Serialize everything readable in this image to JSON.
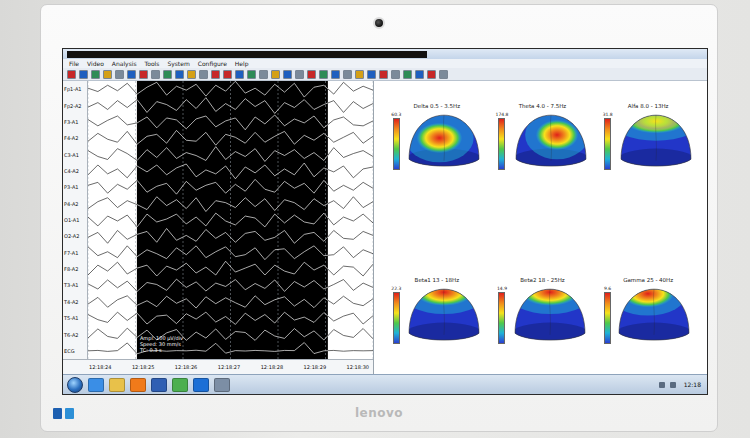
{
  "window": {
    "redacted": true
  },
  "menu": [
    "File",
    "Video",
    "Analysis",
    "Tools",
    "System",
    "Configure",
    "Help"
  ],
  "eeg": {
    "seconds": 6,
    "selection": {
      "start_s": 1.03,
      "end_s": 5.05
    },
    "overlay": [
      "Ampl: 100 µV/div",
      "Speed: 30 mm/s",
      "TC: 0.3 s"
    ],
    "time_ticks": [
      "12:18:24",
      "12:18:25",
      "12:18:26",
      "12:18:27",
      "12:18:28",
      "12:18:29",
      "12:18:30"
    ],
    "channels": [
      {
        "name": "Fp1-A1",
        "values": [
          5,
          -12,
          20,
          -8,
          30,
          -25,
          10,
          35,
          -30,
          15,
          -5,
          25,
          -35,
          20,
          -10,
          40,
          -20,
          5,
          -30,
          25,
          -15,
          30,
          -40,
          10,
          20,
          -25,
          35,
          -10,
          15,
          -5
        ]
      },
      {
        "name": "Fp2-A2",
        "values": [
          -8,
          15,
          -20,
          25,
          -10,
          30,
          -35,
          20,
          5,
          -25,
          30,
          -15,
          40,
          -30,
          10,
          -20,
          35,
          -5,
          25,
          -40,
          15,
          -10,
          30,
          -20,
          5,
          25,
          -35,
          20,
          -15,
          10
        ]
      },
      {
        "name": "F3-A1",
        "values": [
          12,
          -20,
          8,
          30,
          -15,
          -5,
          25,
          -30,
          20,
          10,
          -35,
          15,
          30,
          -25,
          5,
          20,
          -40,
          25,
          -10,
          35,
          -20,
          15,
          -5,
          30,
          -30,
          10,
          25,
          -15,
          -20,
          5
        ]
      },
      {
        "name": "F4-A2",
        "values": [
          -15,
          25,
          -5,
          -20,
          35,
          -30,
          10,
          20,
          -25,
          40,
          -10,
          -15,
          30,
          -35,
          20,
          5,
          -25,
          30,
          -20,
          10,
          35,
          -30,
          15,
          -10,
          25,
          -20,
          5,
          30,
          -25,
          10
        ]
      },
      {
        "name": "C3-A1",
        "values": [
          20,
          -10,
          -25,
          30,
          5,
          -30,
          25,
          -15,
          35,
          -20,
          10,
          -5,
          -30,
          40,
          -25,
          15,
          -10,
          30,
          -35,
          20,
          -5,
          25,
          -20,
          10,
          -30,
          35,
          -15,
          5,
          20,
          -10
        ]
      },
      {
        "name": "C4-A2",
        "values": [
          -20,
          30,
          -15,
          10,
          -35,
          25,
          -5,
          30,
          -20,
          15,
          35,
          -30,
          5,
          -15,
          25,
          -40,
          20,
          -10,
          30,
          -25,
          10,
          -20,
          40,
          -30,
          15,
          -5,
          25,
          -35,
          10,
          20
        ]
      },
      {
        "name": "P3-A1",
        "values": [
          10,
          25,
          -30,
          15,
          -10,
          35,
          -25,
          5,
          20,
          -35,
          30,
          -15,
          10,
          25,
          -30,
          15,
          -20,
          40,
          -10,
          -25,
          30,
          -5,
          20,
          -30,
          35,
          -20,
          10,
          -15,
          25,
          -5
        ]
      },
      {
        "name": "P4-A2",
        "values": [
          -25,
          10,
          30,
          -20,
          15,
          -5,
          -30,
          35,
          -10,
          20,
          -25,
          30,
          -40,
          15,
          5,
          -20,
          30,
          -15,
          25,
          -35,
          20,
          5,
          -30,
          25,
          -10,
          15,
          -25,
          35,
          -20,
          10
        ]
      },
      {
        "name": "O1-A1",
        "values": [
          15,
          -30,
          20,
          -5,
          25,
          -35,
          30,
          -10,
          5,
          30,
          -20,
          15,
          -30,
          35,
          -5,
          -25,
          20,
          10,
          -35,
          30,
          -15,
          25,
          -10,
          -20,
          35,
          -25,
          15,
          -5,
          30,
          -15
        ]
      },
      {
        "name": "O2-A2",
        "values": [
          -5,
          20,
          -35,
          30,
          -15,
          10,
          25,
          -30,
          40,
          -20,
          5,
          -25,
          35,
          -10,
          20,
          -30,
          15,
          25,
          -20,
          -5,
          30,
          -35,
          10,
          20,
          -25,
          30,
          -10,
          -15,
          25,
          5
        ]
      },
      {
        "name": "F7-A1",
        "values": [
          30,
          -15,
          5,
          -25,
          35,
          -20,
          15,
          -5,
          -30,
          25,
          -10,
          35,
          -25,
          5,
          30,
          -20,
          -10,
          25,
          -35,
          15,
          20,
          -30,
          5,
          35,
          -15,
          -10,
          30,
          -25,
          15,
          -5
        ]
      },
      {
        "name": "F8-A2",
        "values": [
          -30,
          20,
          -10,
          35,
          -25,
          5,
          20,
          -35,
          15,
          -5,
          30,
          -20,
          10,
          -30,
          40,
          -15,
          5,
          25,
          -30,
          20,
          -10,
          -25,
          35,
          -5,
          20,
          -30,
          15,
          10,
          -35,
          25
        ]
      },
      {
        "name": "T3-A1",
        "values": [
          8,
          -18,
          28,
          -12,
          22,
          -30,
          15,
          5,
          -25,
          32,
          -10,
          18,
          -28,
          12,
          -5,
          30,
          -22,
          10,
          -15,
          28,
          -30,
          20,
          -8,
          25,
          -18,
          5,
          30,
          -25,
          12,
          -10
        ]
      },
      {
        "name": "T4-A2",
        "values": [
          -12,
          22,
          -28,
          10,
          30,
          -18,
          5,
          -25,
          28,
          -8,
          15,
          -32,
          25,
          -10,
          20,
          -5,
          -28,
          30,
          -15,
          10,
          25,
          -22,
          12,
          -30,
          20,
          -12,
          28,
          -8,
          -20,
          15
        ]
      },
      {
        "name": "T5-A1",
        "values": [
          18,
          -8,
          -22,
          30,
          -12,
          25,
          -30,
          10,
          15,
          -28,
          22,
          -5,
          30,
          -20,
          8,
          -32,
          25,
          -12,
          18,
          -25,
          30,
          -10,
          5,
          -22,
          28,
          -15,
          10,
          25,
          -30,
          12
        ]
      },
      {
        "name": "T6-A2",
        "values": [
          -18,
          28,
          -10,
          -20,
          32,
          -15,
          22,
          -28,
          8,
          25,
          -30,
          12,
          -18,
          28,
          -25,
          15,
          10,
          -30,
          22,
          -8,
          -20,
          30,
          -12,
          18,
          -28,
          25,
          -5,
          -15,
          30,
          -22
        ]
      },
      {
        "name": "ECG",
        "values": [
          0,
          2,
          -3,
          1,
          40,
          -15,
          0,
          2,
          -2,
          1,
          0,
          3,
          -2,
          38,
          -12,
          1,
          -1,
          2,
          0,
          -3,
          2,
          1,
          42,
          -14,
          0,
          2,
          -2,
          1,
          0,
          1
        ]
      }
    ]
  },
  "maps": [
    {
      "title": "Delta 0.5 - 3.5Hz",
      "max": "60.3",
      "kind": "central-left"
    },
    {
      "title": "Theta 4.0 - 7.5Hz",
      "max": "174.8",
      "kind": "central-right"
    },
    {
      "title": "Alfa 8.0 - 13Hz",
      "max": "31.8",
      "kind": "frontal-weak"
    },
    {
      "title": "Beta1 13 - 18Hz",
      "max": "22.3",
      "kind": "frontal"
    },
    {
      "title": "Beta2 18 - 25Hz",
      "max": "14.9",
      "kind": "frontal"
    },
    {
      "title": "Gamma 25 - 40Hz",
      "max": "9.6",
      "kind": "frontal-left"
    }
  ],
  "taskbar": {
    "clock": "12:18"
  },
  "monitor": {
    "logo": "lenovo"
  }
}
